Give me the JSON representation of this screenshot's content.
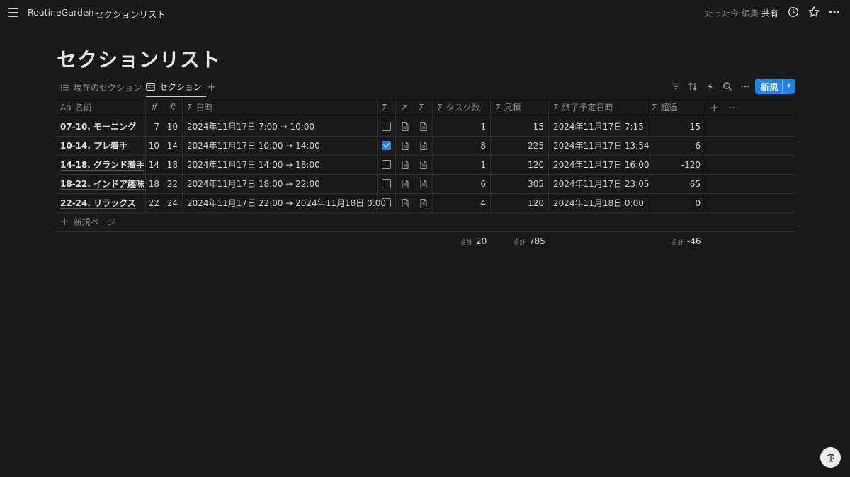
{
  "topbar": {
    "workspace": "RoutineGarden",
    "separator": "/",
    "page": "セクションリスト",
    "edited": "たった今 編集",
    "share": "共有"
  },
  "title": "セクションリスト",
  "tabs": [
    {
      "label": "現在のセクション",
      "icon": "list-icon",
      "active": false
    },
    {
      "label": "セクション",
      "icon": "table-icon",
      "active": true
    }
  ],
  "toolbar": {
    "new_label": "新規"
  },
  "columns": [
    {
      "label": "名前",
      "prefix": "Aa"
    },
    {
      "label": "",
      "prefix": "#"
    },
    {
      "label": "",
      "prefix": "#"
    },
    {
      "label": "日時",
      "prefix": "Σ"
    },
    {
      "label": "",
      "prefix": "Σ"
    },
    {
      "label": "",
      "prefix": "↗"
    },
    {
      "label": "",
      "prefix": "Σ"
    },
    {
      "label": "タスク数",
      "prefix": "Σ"
    },
    {
      "label": "見積",
      "prefix": "Σ"
    },
    {
      "label": "終了予定日時",
      "prefix": "Σ"
    },
    {
      "label": "超過",
      "prefix": "Σ"
    }
  ],
  "rows": [
    {
      "name": "07-10. モーニング",
      "start": "7",
      "end": "10",
      "datetime": "2024年11月17日 7:00 → 10:00",
      "checked": false,
      "tasks": "1",
      "estimate": "15",
      "end_time": "2024年11月17日 7:15",
      "over": "15"
    },
    {
      "name": "10-14. プレ着手",
      "start": "10",
      "end": "14",
      "datetime": "2024年11月17日 10:00 → 14:00",
      "checked": true,
      "tasks": "8",
      "estimate": "225",
      "end_time": "2024年11月17日 13:54",
      "over": "-6"
    },
    {
      "name": "14-18. グランド着手",
      "start": "14",
      "end": "18",
      "datetime": "2024年11月17日 14:00 → 18:00",
      "checked": false,
      "tasks": "1",
      "estimate": "120",
      "end_time": "2024年11月17日 16:00",
      "over": "-120"
    },
    {
      "name": "18-22. インドア趣味",
      "start": "18",
      "end": "22",
      "datetime": "2024年11月17日 18:00 → 22:00",
      "checked": false,
      "tasks": "6",
      "estimate": "305",
      "end_time": "2024年11月17日 23:05",
      "over": "65"
    },
    {
      "name": "22-24. リラックス",
      "start": "22",
      "end": "24",
      "datetime": "2024年11月17日 22:00 → 2024年11月18日 0:00",
      "checked": false,
      "tasks": "4",
      "estimate": "120",
      "end_time": "2024年11月18日 0:00",
      "over": "0"
    }
  ],
  "add_row_label": "新規ページ",
  "sums": {
    "label": "合計",
    "tasks": "20",
    "estimate": "785",
    "over": "-46"
  },
  "colors": {
    "background": "#191919",
    "accent": "#2383e2",
    "text": "#d4d4d4",
    "muted": "#7f7f7f"
  }
}
